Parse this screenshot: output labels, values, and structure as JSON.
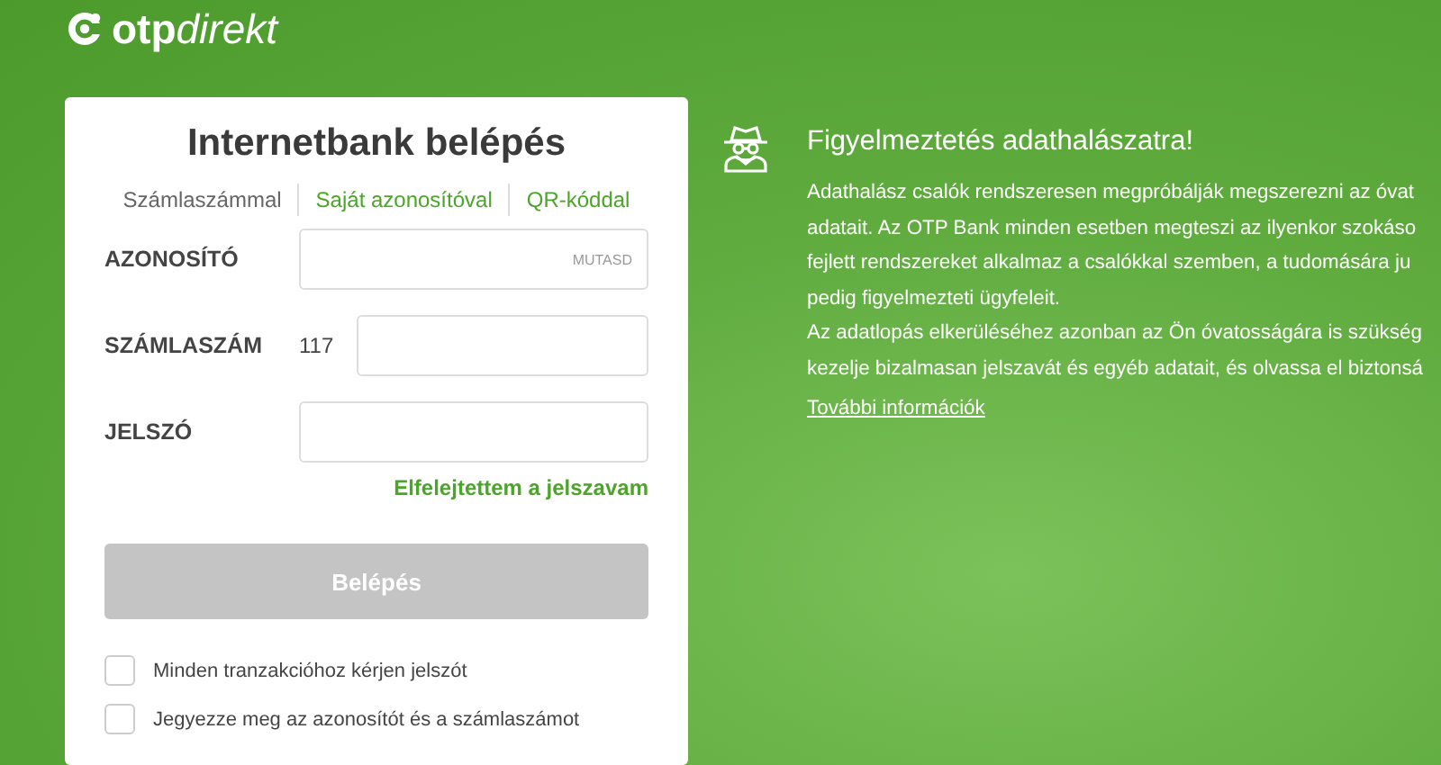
{
  "logo": {
    "brand": "otp",
    "suffix": "direkt"
  },
  "login": {
    "title": "Internetbank belépés",
    "tabs": [
      {
        "label": "Számlaszámmal",
        "selected": true
      },
      {
        "label": "Saját azonosítóval",
        "selected": false
      },
      {
        "label": "QR-kóddal",
        "selected": false
      }
    ],
    "fields": [
      {
        "label": "AZONOSÍTÓ",
        "kind": "reveal",
        "action": "MUTASD"
      },
      {
        "label": "SZÁMLASZÁM",
        "kind": "prefixed",
        "prefix": "117"
      },
      {
        "label": "JELSZÓ",
        "kind": "plain"
      }
    ],
    "forgot_link": "Elfelejtettem a jelszavam",
    "submit": {
      "label": "Belépés",
      "disabled": true
    },
    "options": [
      {
        "label": "Minden tranzakcióhoz kérjen jelszót",
        "checked": false
      },
      {
        "label": "Jegyezze meg az azonosítót és a számlaszámot",
        "checked": false
      }
    ]
  },
  "warning": {
    "title": "Figyelmeztetés adathalászatra!",
    "lines": [
      "Adathalász csalók rendszeresen megpróbálják megszerezni az óvat",
      "adatait. Az OTP Bank minden esetben megteszi az ilyenkor szokáso",
      "fejlett rendszereket alkalmaz a csalókkal szemben, a tudomására ju",
      "pedig figyelmezteti ügyfeleit.",
      "Az adatlopás elkerüléséhez azonban az Ön óvatosságára is szükség",
      "kezelje bizalmasan jelszavát és egyéb adatait, és olvassa el biztonsá"
    ],
    "link": "További információk"
  }
}
